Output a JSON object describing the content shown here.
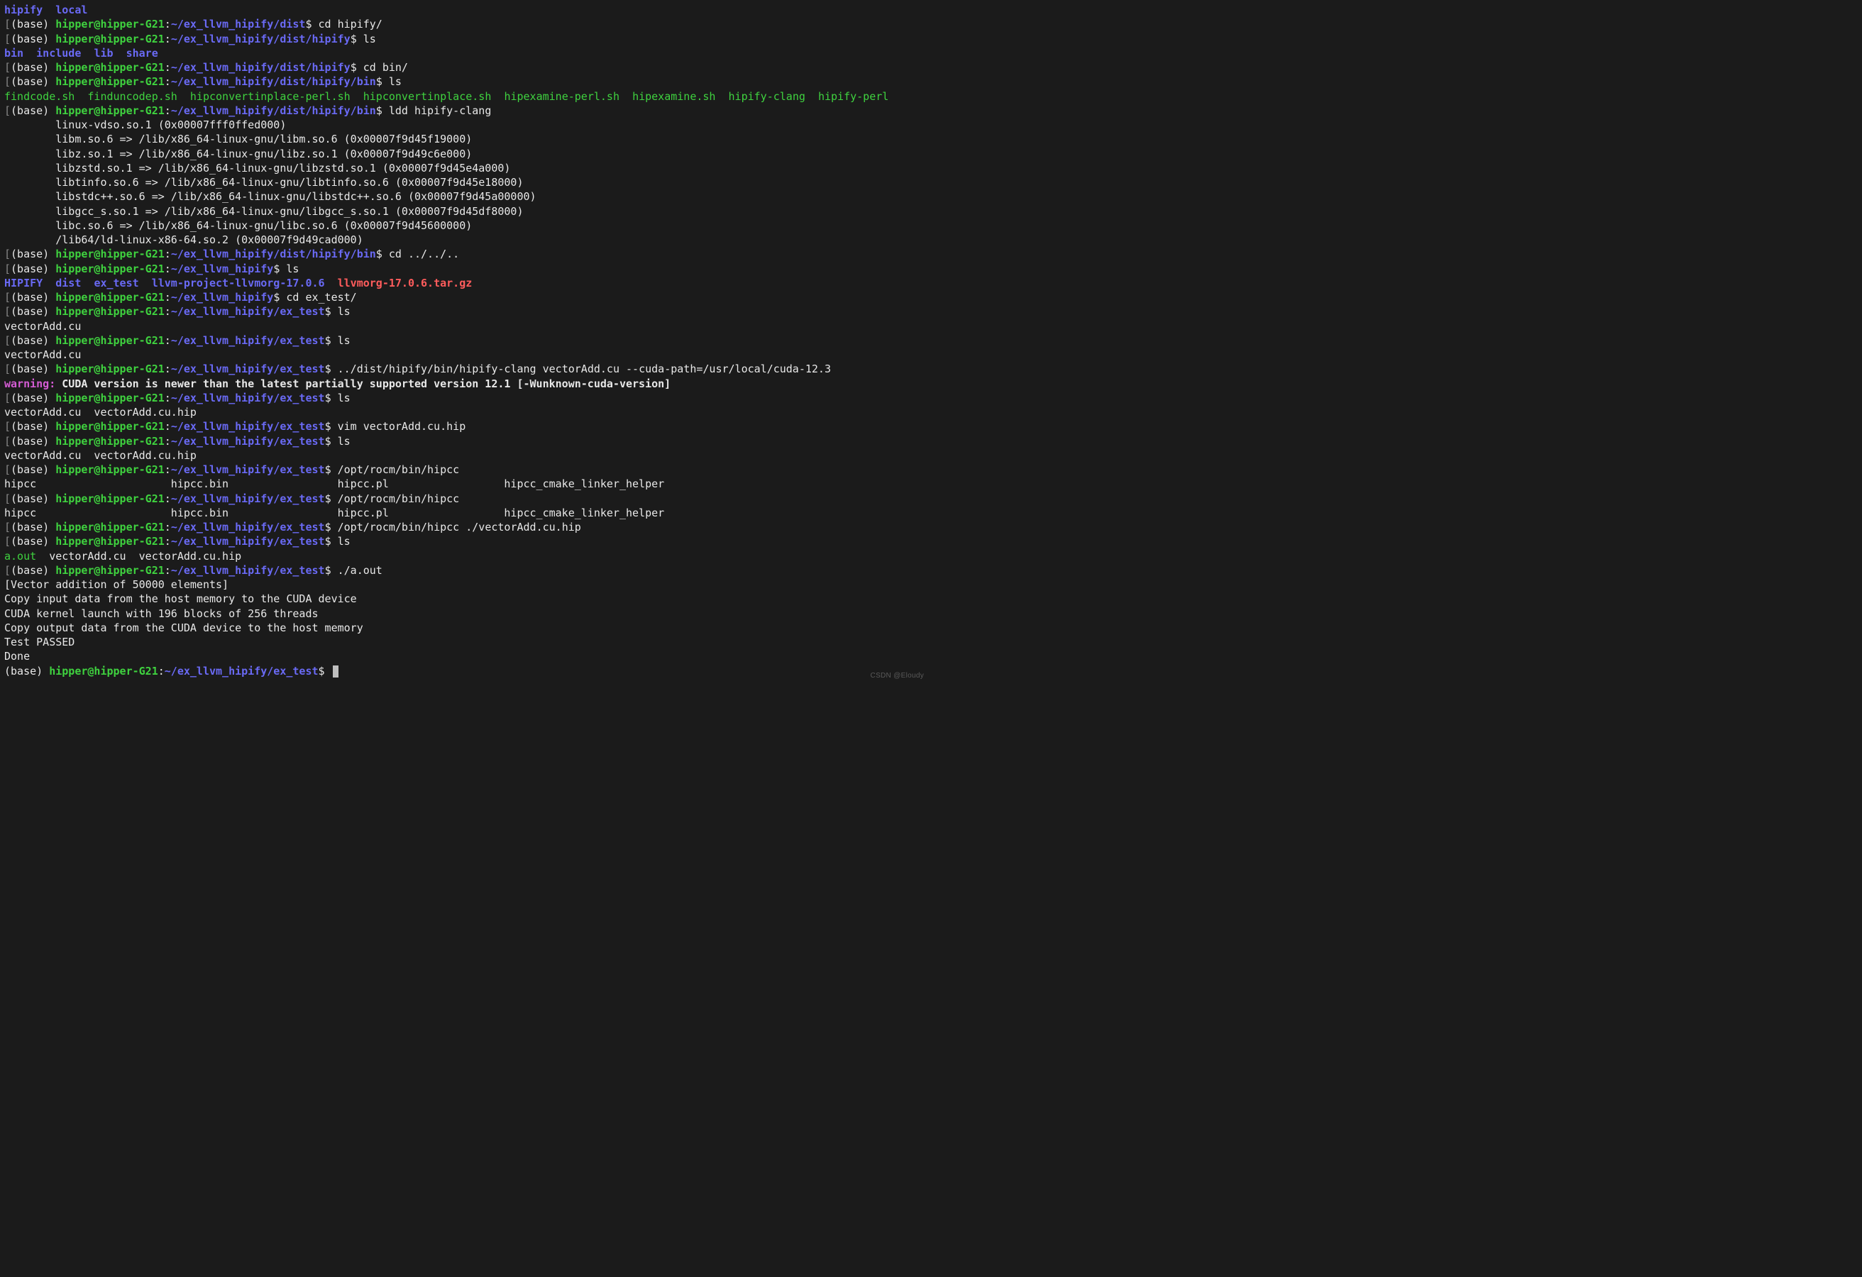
{
  "ls_top": [
    "hipify",
    "local"
  ],
  "p1": {
    "env": "(base)",
    "user": "hipper@hipper-G21",
    "path": "~/ex_llvm_hipify/dist",
    "cmd": "cd hipify/"
  },
  "p2": {
    "env": "(base)",
    "user": "hipper@hipper-G21",
    "path": "~/ex_llvm_hipify/dist/hipify",
    "cmd": "ls"
  },
  "ls_hipify": [
    "bin",
    "include",
    "lib",
    "share"
  ],
  "p3": {
    "env": "(base)",
    "user": "hipper@hipper-G21",
    "path": "~/ex_llvm_hipify/dist/hipify",
    "cmd": "cd bin/"
  },
  "p4": {
    "env": "(base)",
    "user": "hipper@hipper-G21",
    "path": "~/ex_llvm_hipify/dist/hipify/bin",
    "cmd": "ls"
  },
  "ls_bin": [
    "findcode.sh",
    "finduncodep.sh",
    "hipconvertinplace-perl.sh",
    "hipconvertinplace.sh",
    "hipexamine-perl.sh",
    "hipexamine.sh",
    "hipify-clang",
    "hipify-perl"
  ],
  "p5": {
    "env": "(base)",
    "user": "hipper@hipper-G21",
    "path": "~/ex_llvm_hipify/dist/hipify/bin",
    "cmd": "ldd hipify-clang"
  },
  "ldd": [
    "linux-vdso.so.1 (0x00007fff0ffed000)",
    "libm.so.6 => /lib/x86_64-linux-gnu/libm.so.6 (0x00007f9d45f19000)",
    "libz.so.1 => /lib/x86_64-linux-gnu/libz.so.1 (0x00007f9d49c6e000)",
    "libzstd.so.1 => /lib/x86_64-linux-gnu/libzstd.so.1 (0x00007f9d45e4a000)",
    "libtinfo.so.6 => /lib/x86_64-linux-gnu/libtinfo.so.6 (0x00007f9d45e18000)",
    "libstdc++.so.6 => /lib/x86_64-linux-gnu/libstdc++.so.6 (0x00007f9d45a00000)",
    "libgcc_s.so.1 => /lib/x86_64-linux-gnu/libgcc_s.so.1 (0x00007f9d45df8000)",
    "libc.so.6 => /lib/x86_64-linux-gnu/libc.so.6 (0x00007f9d45600000)",
    "/lib64/ld-linux-x86-64.so.2 (0x00007f9d49cad000)"
  ],
  "p6": {
    "env": "(base)",
    "user": "hipper@hipper-G21",
    "path": "~/ex_llvm_hipify/dist/hipify/bin",
    "cmd": "cd ../../.."
  },
  "p7": {
    "env": "(base)",
    "user": "hipper@hipper-G21",
    "path": "~/ex_llvm_hipify",
    "cmd": "ls"
  },
  "ls_root": {
    "dirs": [
      "HIPIFY",
      "dist",
      "ex_test",
      "llvm-project-llvmorg-17.0.6"
    ],
    "file": "llvmorg-17.0.6.tar.gz"
  },
  "p8": {
    "env": "(base)",
    "user": "hipper@hipper-G21",
    "path": "~/ex_llvm_hipify",
    "cmd": "cd ex_test/"
  },
  "p9": {
    "env": "(base)",
    "user": "hipper@hipper-G21",
    "path": "~/ex_llvm_hipify/ex_test",
    "cmd": "ls"
  },
  "ls_ex1": "vectorAdd.cu",
  "p10": {
    "env": "(base)",
    "user": "hipper@hipper-G21",
    "path": "~/ex_llvm_hipify/ex_test",
    "cmd": "ls"
  },
  "p11": {
    "env": "(base)",
    "user": "hipper@hipper-G21",
    "path": "~/ex_llvm_hipify/ex_test",
    "cmd": "../dist/hipify/bin/hipify-clang vectorAdd.cu --cuda-path=/usr/local/cuda-12.3"
  },
  "warning": {
    "label": "warning:",
    "msg": "CUDA version is newer than the latest partially supported version 12.1 [-Wunknown-cuda-version]"
  },
  "p12": {
    "env": "(base)",
    "user": "hipper@hipper-G21",
    "path": "~/ex_llvm_hipify/ex_test",
    "cmd": "ls"
  },
  "ls_ex2": "vectorAdd.cu  vectorAdd.cu.hip",
  "p13": {
    "env": "(base)",
    "user": "hipper@hipper-G21",
    "path": "~/ex_llvm_hipify/ex_test",
    "cmd": "vim vectorAdd.cu.hip"
  },
  "p14": {
    "env": "(base)",
    "user": "hipper@hipper-G21",
    "path": "~/ex_llvm_hipify/ex_test",
    "cmd": "ls"
  },
  "p15": {
    "env": "(base)",
    "user": "hipper@hipper-G21",
    "path": "~/ex_llvm_hipify/ex_test",
    "cmd": "/opt/rocm/bin/hipcc"
  },
  "hipcc_row": "hipcc                     hipcc.bin                 hipcc.pl                  hipcc_cmake_linker_helper",
  "p16": {
    "env": "(base)",
    "user": "hipper@hipper-G21",
    "path": "~/ex_llvm_hipify/ex_test",
    "cmd": "/opt/rocm/bin/hipcc"
  },
  "p17": {
    "env": "(base)",
    "user": "hipper@hipper-G21",
    "path": "~/ex_llvm_hipify/ex_test",
    "cmd": "/opt/rocm/bin/hipcc ./vectorAdd.cu.hip"
  },
  "p18": {
    "env": "(base)",
    "user": "hipper@hipper-G21",
    "path": "~/ex_llvm_hipify/ex_test",
    "cmd": "ls"
  },
  "ls_ex3": {
    "exe": "a.out",
    "rest": "vectorAdd.cu  vectorAdd.cu.hip"
  },
  "p19": {
    "env": "(base)",
    "user": "hipper@hipper-G21",
    "path": "~/ex_llvm_hipify/ex_test",
    "cmd": "./a.out"
  },
  "run_out": [
    "[Vector addition of 50000 elements]",
    "Copy input data from the host memory to the CUDA device",
    "CUDA kernel launch with 196 blocks of 256 threads",
    "Copy output data from the CUDA device to the host memory",
    "Test PASSED",
    "Done"
  ],
  "p20": {
    "env": "(base)",
    "user": "hipper@hipper-G21",
    "path": "~/ex_llvm_hipify/ex_test",
    "cmd": ""
  },
  "watermark": "CSDN @Eloudy"
}
